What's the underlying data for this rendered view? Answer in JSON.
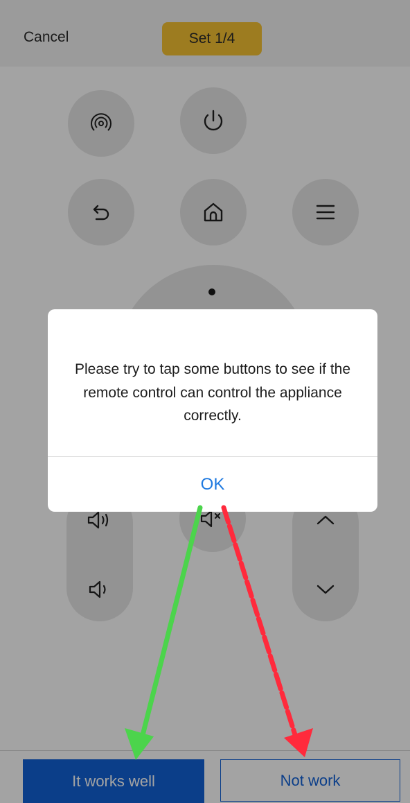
{
  "header": {
    "cancel_label": "Cancel",
    "step_label": "Set 1/4",
    "step_highlight_color": "#f6c233"
  },
  "remote": {
    "buttons": [
      {
        "name": "signal",
        "icon": "signal-icon"
      },
      {
        "name": "power",
        "icon": "power-icon"
      },
      {
        "name": "back",
        "icon": "back-arrow-icon"
      },
      {
        "name": "home",
        "icon": "home-icon"
      },
      {
        "name": "menu",
        "icon": "menu-icon"
      },
      {
        "name": "volume-up",
        "icon": "volume-up-icon"
      },
      {
        "name": "volume-down",
        "icon": "volume-down-icon"
      },
      {
        "name": "mute",
        "icon": "mute-icon"
      },
      {
        "name": "channel-up",
        "icon": "chevron-up-icon"
      },
      {
        "name": "channel-down",
        "icon": "chevron-down-icon"
      }
    ]
  },
  "dialog": {
    "message": "Please try to tap some buttons to see if the remote control can control the appliance correctly.",
    "ok_label": "OK",
    "ok_color": "#1f7ae0"
  },
  "footer": {
    "works_label": "It works well",
    "not_work_label": "Not work",
    "primary_color": "#1261d6"
  },
  "annotations": {
    "green_arrow_color": "#4cd44c",
    "red_arrow_color": "#ff2a3c"
  }
}
